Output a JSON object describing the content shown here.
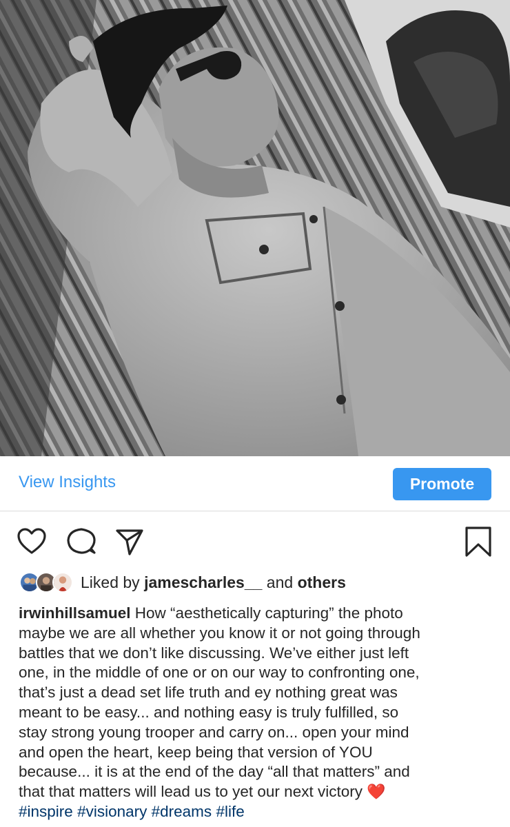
{
  "post": {
    "photo": {
      "alt_kind": "photo-black-and-white"
    },
    "insights": {
      "view_insights_label": "View Insights",
      "promote_label": "Promote",
      "accent_color": "#3897f0"
    },
    "actions": {
      "icons": [
        "heart-icon",
        "comment-icon",
        "share-icon",
        "bookmark-icon"
      ]
    },
    "likes": {
      "prefix": "Liked by ",
      "user": "jamescharles__",
      "middle": " and ",
      "others": "others"
    },
    "caption": {
      "username": "irwinhillsamuel",
      "lines": [
        " How “aesthetically capturing” the photo",
        "maybe we are all whether you know it or not going through",
        "battles that we don’t like discussing. We’ve either just left",
        "one, in the middle of one or on our way to confronting one,",
        "that’s just a dead set life truth and ey nothing great was",
        "meant to be easy... and nothing easy is truly fulfilled, so",
        "stay strong young trooper and carry on... open your mind",
        "and open the heart, keep being that version of YOU",
        "because... it is at the end of the day “all that matters” and",
        "that that matters will lead us to yet our next victory "
      ],
      "emoji": "❤️",
      "hashtags": [
        "#inspire",
        "#visionary",
        "#dreams",
        "#life"
      ]
    }
  }
}
